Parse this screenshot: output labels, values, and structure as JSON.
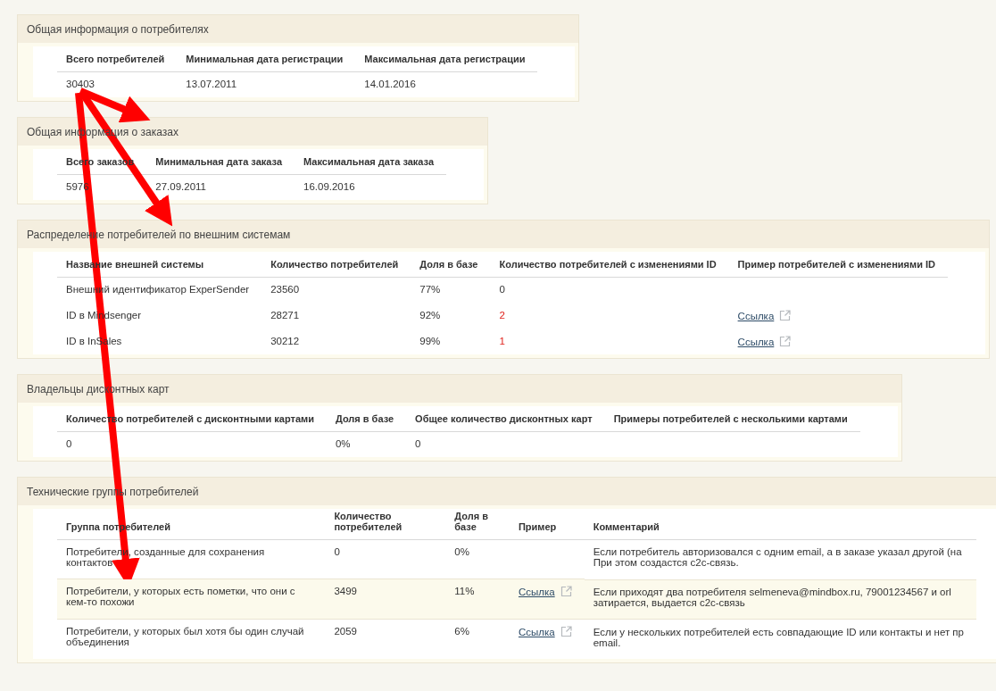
{
  "sections": [
    {
      "title": "Общая информация о потребителях",
      "columns": [
        "Всего потребителей",
        "Минимальная дата регистрации",
        "Максимальная дата регистрации"
      ],
      "rows": [
        {
          "highlighted": false,
          "cells": [
            {
              "kind": "text",
              "text": "30403"
            },
            {
              "kind": "text",
              "text": "13.07.2011"
            },
            {
              "kind": "text",
              "text": "14.01.2016"
            }
          ]
        }
      ]
    },
    {
      "title": "Общая информация о заказах",
      "columns": [
        "Всего заказов",
        "Минимальная дата заказа",
        "Максимальная дата заказа"
      ],
      "rows": [
        {
          "highlighted": false,
          "cells": [
            {
              "kind": "text",
              "text": "5976"
            },
            {
              "kind": "text",
              "text": "27.09.2011"
            },
            {
              "kind": "text",
              "text": "16.09.2016"
            }
          ]
        }
      ]
    },
    {
      "title": "Распределение потребителей по внешним системам",
      "columns": [
        "Название внешней системы",
        "Количество потребителей",
        "Доля в базе",
        "Количество потребителей с изменениями ID",
        "Пример потребителей с изменениями ID"
      ],
      "rows": [
        {
          "highlighted": false,
          "cells": [
            {
              "kind": "text",
              "text": "Внешний идентификатор ExperSender"
            },
            {
              "kind": "text",
              "text": "23560"
            },
            {
              "kind": "text",
              "text": "77%"
            },
            {
              "kind": "count",
              "text": "0",
              "alert": false
            },
            null
          ]
        },
        {
          "highlighted": false,
          "cells": [
            {
              "kind": "text",
              "text": "ID в Mindsenger"
            },
            {
              "kind": "text",
              "text": "28271"
            },
            {
              "kind": "text",
              "text": "92%"
            },
            {
              "kind": "count",
              "text": "2",
              "alert": true
            },
            {
              "kind": "link",
              "text": "Ссылка"
            }
          ]
        },
        {
          "highlighted": false,
          "cells": [
            {
              "kind": "text",
              "text": "ID в InSales"
            },
            {
              "kind": "text",
              "text": "30212"
            },
            {
              "kind": "text",
              "text": "99%"
            },
            {
              "kind": "count",
              "text": "1",
              "alert": true
            },
            {
              "kind": "link",
              "text": "Ссылка"
            }
          ]
        }
      ]
    },
    {
      "title": "Владельцы дисконтных карт",
      "columns": [
        "Количество потребителей с дисконтными картами",
        "Доля в базе",
        "Общее количество дисконтных карт",
        "Примеры потребителей с несколькими картами"
      ],
      "rows": [
        {
          "highlighted": false,
          "cells": [
            {
              "kind": "text",
              "text": "0"
            },
            {
              "kind": "text",
              "text": "0%"
            },
            {
              "kind": "text",
              "text": "0"
            },
            null
          ]
        }
      ]
    },
    {
      "title": "Технические группы потребителей",
      "columns": [
        "Группа потребителей",
        "Количество потребителей",
        "Доля в базе",
        "Пример",
        "Комментарий"
      ],
      "rows": [
        {
          "highlighted": false,
          "cells": [
            {
              "kind": "text",
              "text": "Потребители, созданные для сохранения контактов"
            },
            {
              "kind": "text",
              "text": "0"
            },
            {
              "kind": "text",
              "text": "0%"
            },
            null,
            {
              "kind": "lines",
              "lines": [
                "Если потребитель авторизовался с одним email, а в заказе указал другой (на",
                "При этом создастся c2c-связь."
              ]
            }
          ]
        },
        {
          "highlighted": true,
          "cells": [
            {
              "kind": "text",
              "text": "Потребители, у которых есть пометки, что они с кем-то похожи"
            },
            {
              "kind": "text",
              "text": "3499"
            },
            {
              "kind": "text",
              "text": "11%"
            },
            {
              "kind": "link",
              "text": "Ссылка"
            },
            {
              "kind": "lines",
              "lines": [
                "Если приходят два потребителя selmeneva@mindbox.ru, 79001234567 и orl",
                "затирается, выдается c2c-связь"
              ]
            }
          ]
        },
        {
          "highlighted": false,
          "cells": [
            {
              "kind": "text",
              "text": "Потребители, у которых был хотя бы один случай объединения"
            },
            {
              "kind": "text",
              "text": "2059"
            },
            {
              "kind": "text",
              "text": "6%"
            },
            {
              "kind": "link",
              "text": "Ссылка"
            },
            {
              "kind": "lines",
              "lines": [
                "Если у нескольких потребителей есть совпадающие ID или контакты и нет пр",
                "email."
              ]
            }
          ]
        }
      ]
    }
  ]
}
